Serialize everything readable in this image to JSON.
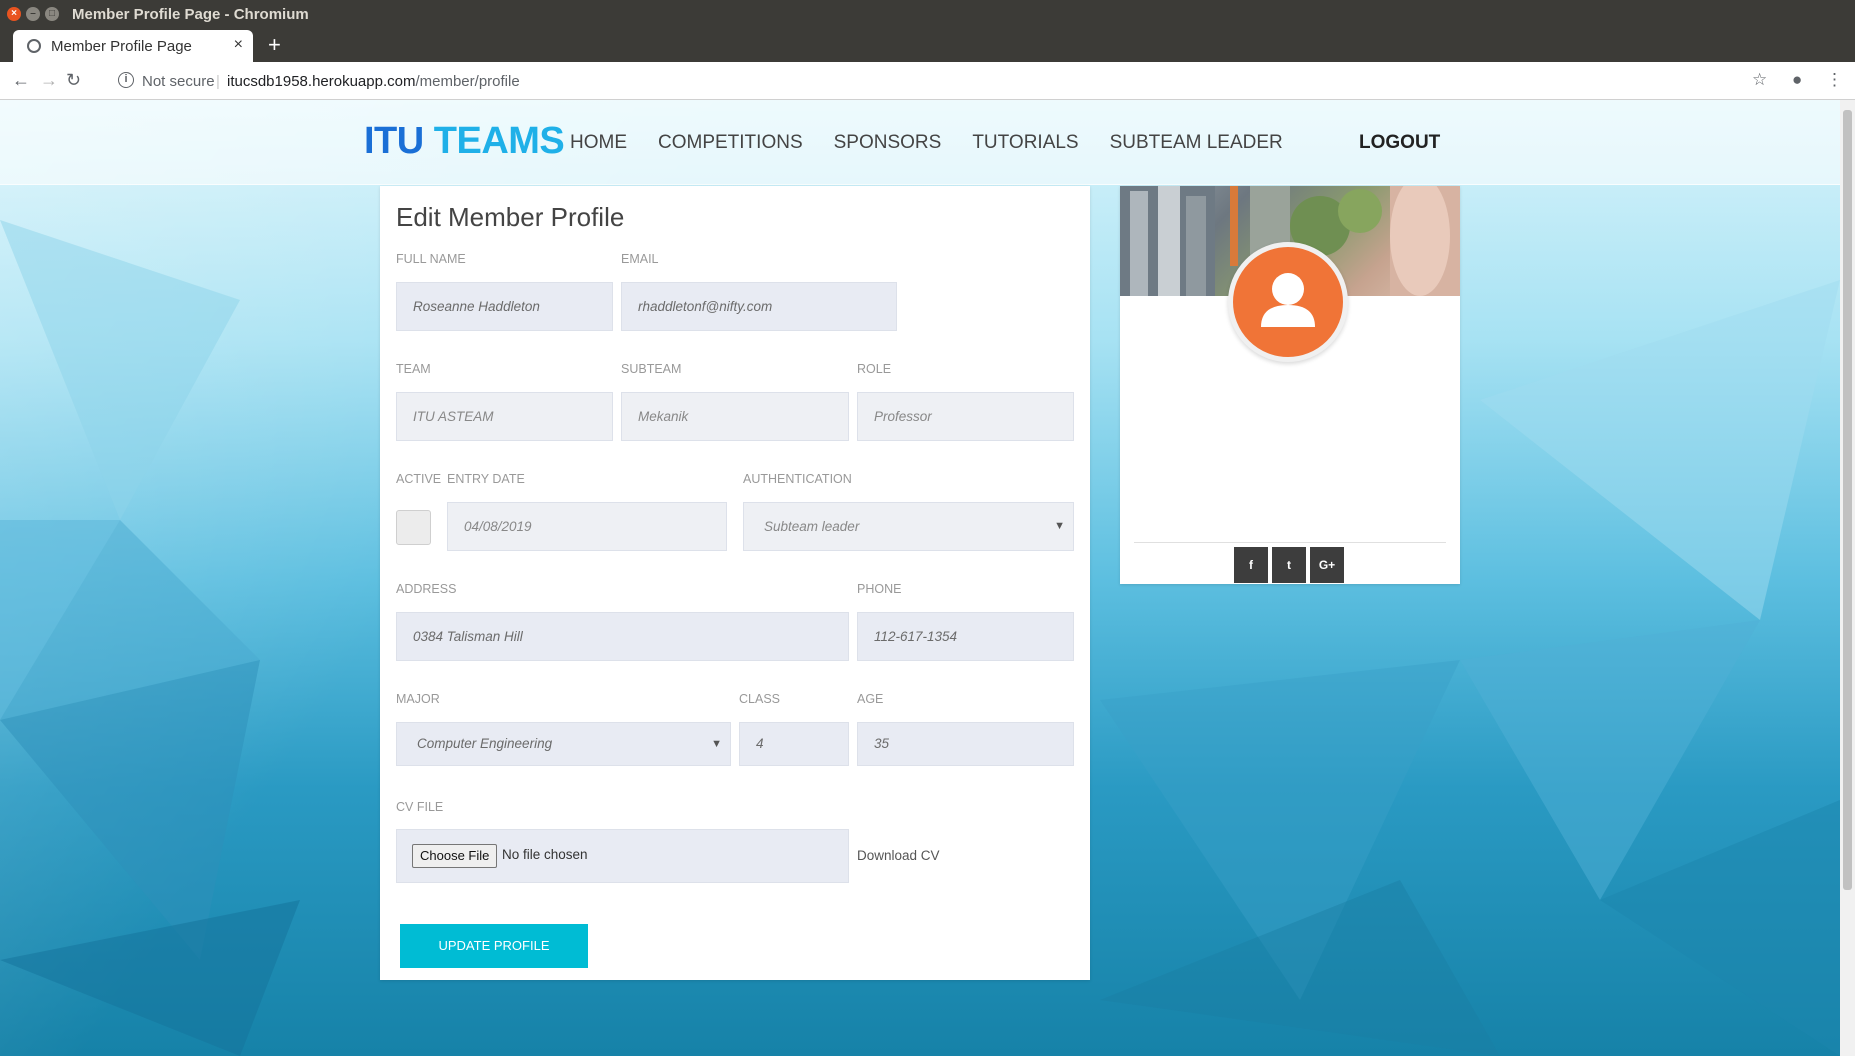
{
  "window": {
    "title": "Member Profile Page - Chromium"
  },
  "browser": {
    "tab_title": "Member Profile Page",
    "not_secure": "Not secure",
    "url_host": "itucsdb1958.herokuapp.com",
    "url_path": "/member/profile"
  },
  "nav": {
    "brand_part1": "ITU ",
    "brand_part2": "TEAMS",
    "links": [
      "HOME",
      "COMPETITIONS",
      "SPONSORS",
      "TUTORIALS",
      "SUBTEAM LEADER"
    ],
    "logout": "LOGOUT"
  },
  "form": {
    "heading": "Edit Member Profile",
    "full_name": {
      "label": "FULL NAME",
      "value": "Roseanne Haddleton"
    },
    "email": {
      "label": "EMAIL",
      "value": "rhaddletonf@nifty.com"
    },
    "team": {
      "label": "TEAM",
      "value": "ITU ASTEAM"
    },
    "subteam": {
      "label": "SUBTEAM",
      "value": "Mekanik"
    },
    "role": {
      "label": "ROLE",
      "value": "Professor"
    },
    "active": {
      "label": "ACTIVE",
      "checked": false
    },
    "entry_date": {
      "label": "ENTRY DATE",
      "value": "04/08/2019"
    },
    "authentication": {
      "label": "AUTHENTICATION",
      "value": "Subteam leader"
    },
    "address": {
      "label": "ADDRESS",
      "value": "0384 Talisman Hill"
    },
    "phone": {
      "label": "PHONE",
      "value": "112-617-1354"
    },
    "major": {
      "label": "MAJOR",
      "value": "Computer Engineering"
    },
    "class": {
      "label": "CLASS",
      "value": "4"
    },
    "age": {
      "label": "AGE",
      "value": "35"
    },
    "cv": {
      "label": "CV FILE",
      "choose": "Choose File",
      "no_file": "No file chosen",
      "download": "Download CV"
    },
    "submit": "UPDATE PROFILE"
  },
  "profile_card": {
    "social": [
      {
        "icon": "facebook-icon",
        "glyph": "f"
      },
      {
        "icon": "twitter-icon",
        "glyph": "t"
      },
      {
        "icon": "google-plus-icon",
        "glyph": "G+"
      }
    ]
  },
  "colors": {
    "brand_dark": "#1a6fd6",
    "brand_light": "#1fb0e8",
    "accent": "#00bcd4",
    "avatar": "#f07437"
  }
}
